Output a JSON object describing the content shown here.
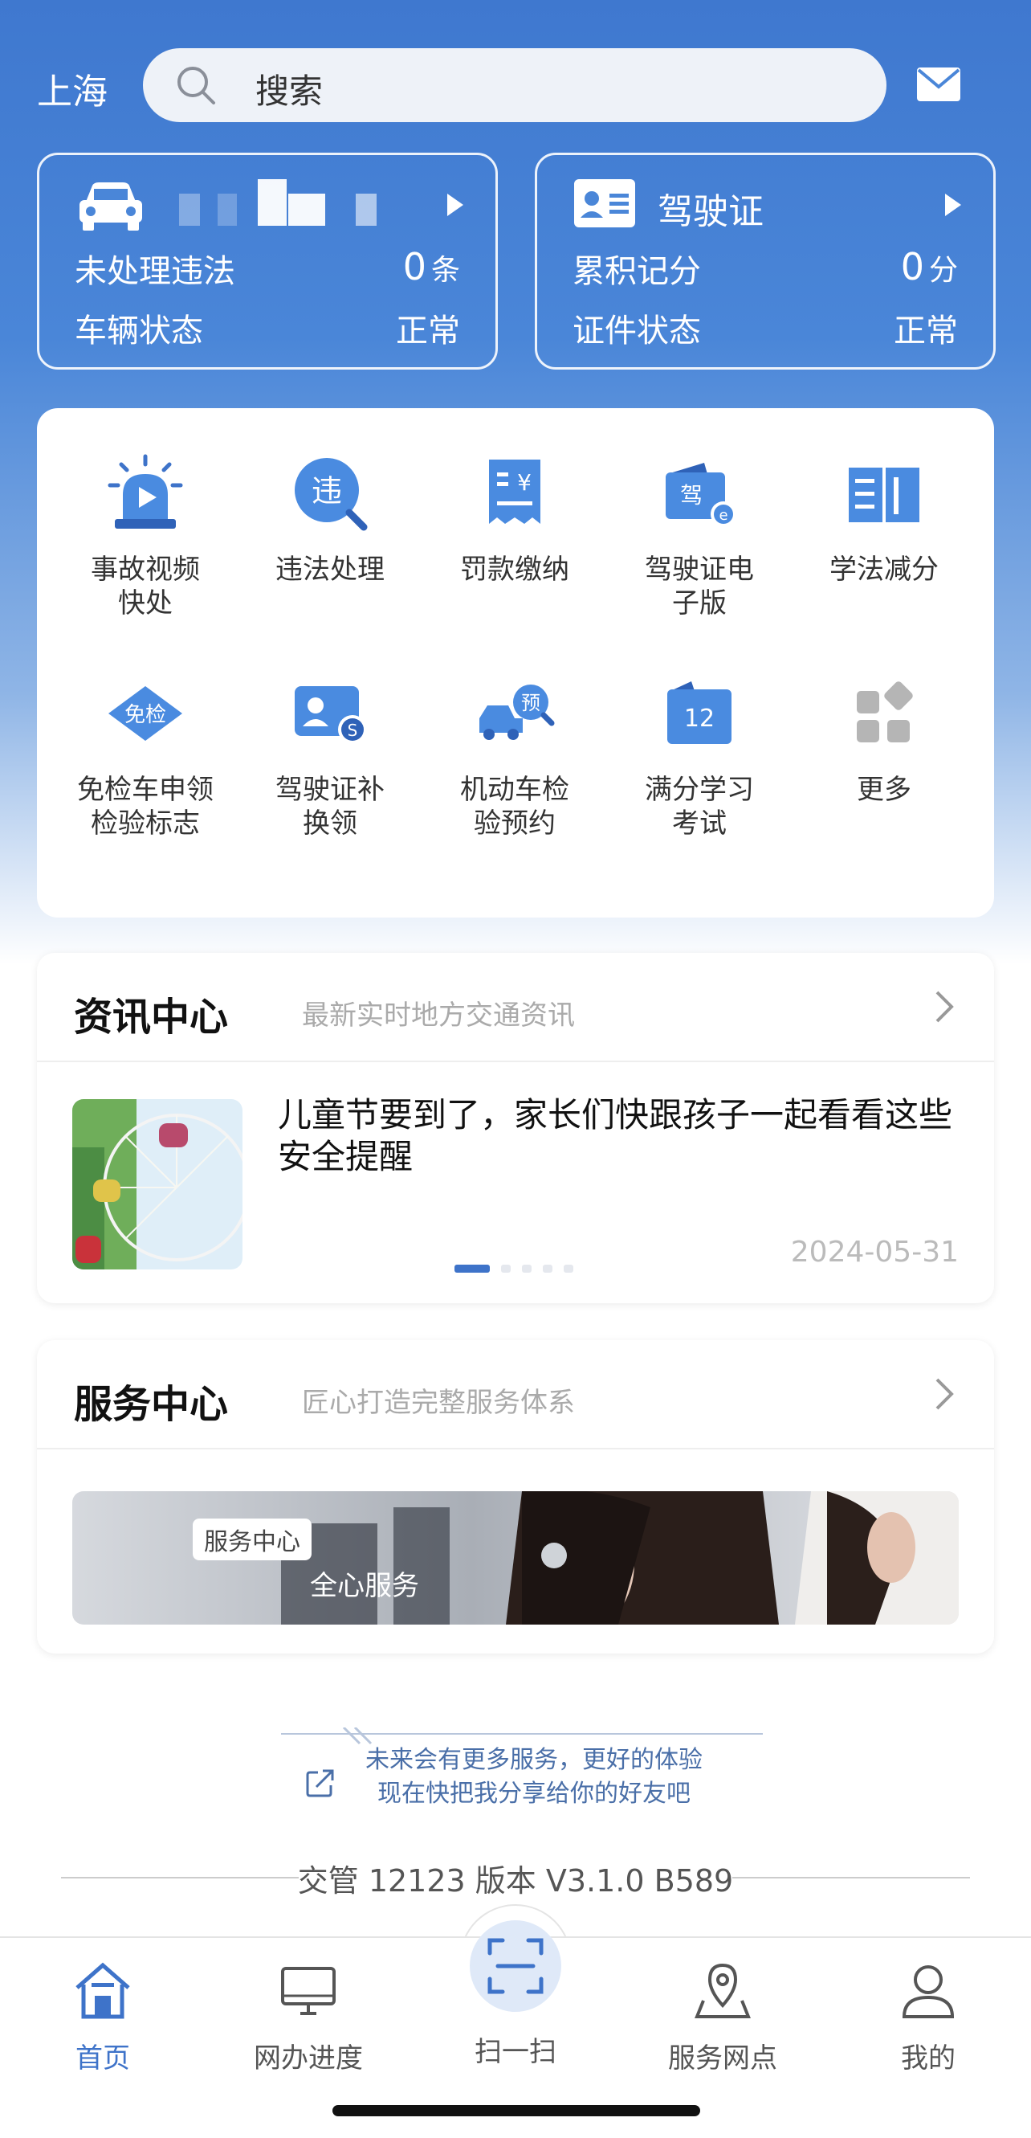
{
  "header": {
    "city": "上海",
    "search_placeholder": "搜索"
  },
  "vehicle_card": {
    "violations_label": "未处理违法",
    "violations_count": "0",
    "violations_unit": "条",
    "status_label": "车辆状态",
    "status_value": "正常"
  },
  "license_card": {
    "title": "驾驶证",
    "points_label": "累积记分",
    "points_count": "0",
    "points_unit": "分",
    "status_label": "证件状态",
    "status_value": "正常"
  },
  "services": [
    {
      "label": "事故视频\n快处",
      "icon": "accident-video-icon"
    },
    {
      "label": "违法处理",
      "icon": "violation-icon"
    },
    {
      "label": "罚款缴纳",
      "icon": "fine-payment-icon"
    },
    {
      "label": "驾驶证电\n子版",
      "icon": "e-license-icon"
    },
    {
      "label": "学法减分",
      "icon": "study-book-icon"
    },
    {
      "label": "免检车申领\n检验标志",
      "icon": "exempt-inspection-icon"
    },
    {
      "label": "驾驶证补\n换领",
      "icon": "license-renew-icon"
    },
    {
      "label": "机动车检\n验预约",
      "icon": "inspection-booking-icon"
    },
    {
      "label": "满分学习\n考试",
      "icon": "full-score-exam-icon"
    },
    {
      "label": "更多",
      "icon": "more-grid-icon"
    }
  ],
  "news": {
    "title": "资讯中心",
    "subtitle": "最新实时地方交通资讯",
    "headline": "儿童节要到了，家长们快跟孩子一起看看这些安全提醒",
    "date": "2024-05-31",
    "carousel_total": 5,
    "carousel_active": 1
  },
  "service_center": {
    "title": "服务中心",
    "subtitle": "匠心打造完整服务体系",
    "banner_tag": "服务中心",
    "banner_text": "全心服务"
  },
  "share": {
    "line1": "未来会有更多服务，更好的体验",
    "line2": "现在快把我分享给你的好友吧"
  },
  "version": "交管 12123 版本 V3.1.0 B589",
  "tabbar": [
    {
      "label": "首页",
      "active": true
    },
    {
      "label": "网办进度",
      "active": false
    },
    {
      "label": "扫一扫",
      "active": false
    },
    {
      "label": "服务网点",
      "active": false
    },
    {
      "label": "我的",
      "active": false
    }
  ],
  "colors": {
    "brand_blue": "#3e73c9",
    "header_blue": "#4a86d8"
  }
}
